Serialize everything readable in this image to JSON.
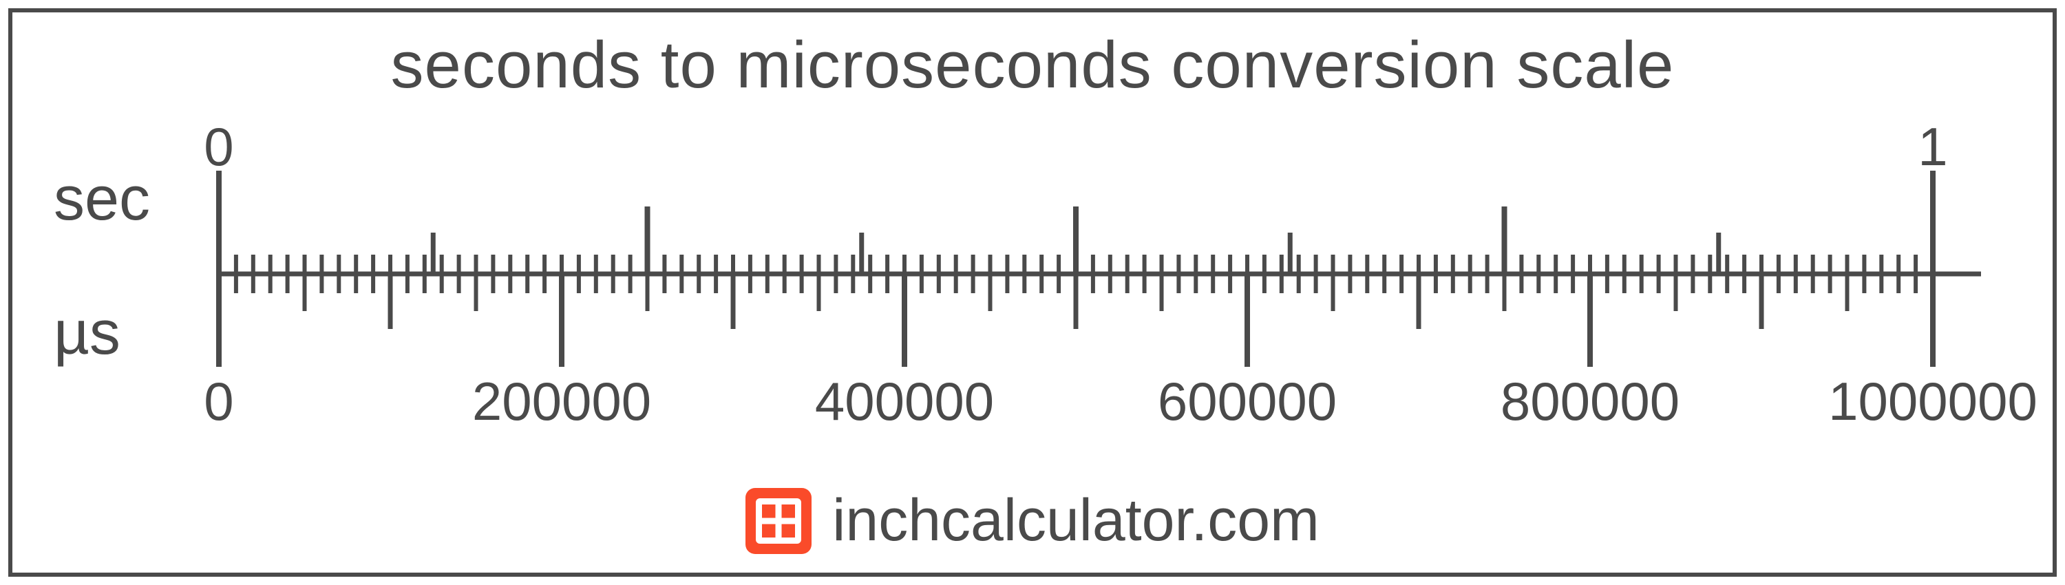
{
  "title": "seconds to microseconds conversion scale",
  "top_unit": "sec",
  "bottom_unit": "µs",
  "top_scale": {
    "min": 0,
    "max": 1,
    "labels": [
      {
        "value": "0",
        "pos": 0
      },
      {
        "value": "1",
        "pos": 1
      }
    ],
    "major_ticks": [
      0,
      0.25,
      0.5,
      0.75,
      1
    ],
    "mid_ticks": [
      0.125,
      0.375,
      0.625,
      0.875
    ],
    "minor_count": 100
  },
  "bottom_scale": {
    "min": 0,
    "max": 1000000,
    "labels": [
      {
        "value": "0",
        "pos": 0.0
      },
      {
        "value": "200000",
        "pos": 0.2
      },
      {
        "value": "400000",
        "pos": 0.4
      },
      {
        "value": "600000",
        "pos": 0.6
      },
      {
        "value": "800000",
        "pos": 0.8
      },
      {
        "value": "1000000",
        "pos": 1.0
      }
    ],
    "major_positions": [
      0,
      0.2,
      0.4,
      0.6,
      0.8,
      1.0
    ],
    "mid_positions": [
      0.1,
      0.3,
      0.5,
      0.7,
      0.9
    ],
    "half_positions": [
      0.05,
      0.15,
      0.25,
      0.35,
      0.45,
      0.55,
      0.65,
      0.75,
      0.85,
      0.95
    ],
    "minor_count": 100
  },
  "footer": {
    "brand": "inchcalculator.com",
    "logo_color": "#fa4b2a"
  },
  "colors": {
    "stroke": "#4a4a4a",
    "accent": "#fa4b2a",
    "bg": "#ffffff"
  }
}
